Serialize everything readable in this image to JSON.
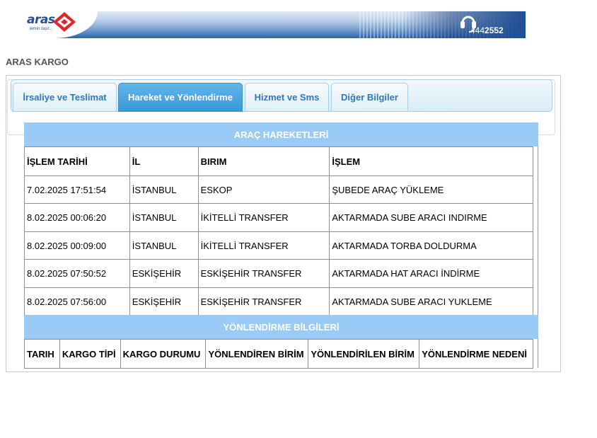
{
  "brand": {
    "logo_text": "aras",
    "slogan": "lemin taşır...",
    "phone_prefix": "444",
    "phone_suffix": "2552",
    "colors": {
      "banner_dark": "#1e4f93",
      "logo_red": "#e3262d",
      "tab_active": "#3b98d8",
      "section_header": "#99cbf6"
    }
  },
  "page_title": "ARAS KARGO",
  "tabs": [
    {
      "label": "İrsaliye ve Teslimat",
      "active": false
    },
    {
      "label": "Hareket ve Yönlendirme",
      "active": true
    },
    {
      "label": "Hizmet ve Sms",
      "active": false
    },
    {
      "label": "Diğer Bilgiler",
      "active": false
    }
  ],
  "vehicle_movements": {
    "title": "ARAÇ HAREKETLERİ",
    "columns": [
      "İŞLEM TARİHİ",
      "İL",
      "BIRIM",
      "İŞLEM"
    ],
    "rows": [
      [
        "7.02.2025 17:51:54",
        "İSTANBUL",
        "ESKOP",
        "ŞUBEDE ARAÇ YÜKLEME"
      ],
      [
        "8.02.2025 00:06:20",
        "İSTANBUL",
        "İKİTELLİ TRANSFER",
        "AKTARMADA SUBE ARACI INDIRME"
      ],
      [
        "8.02.2025 00:09:00",
        "İSTANBUL",
        "İKİTELLİ TRANSFER",
        "AKTARMADA TORBA DOLDURMA"
      ],
      [
        "8.02.2025 07:50:52",
        "ESKİŞEHİR",
        "ESKİŞEHİR TRANSFER",
        "AKTARMADA HAT ARACI İNDİRME"
      ],
      [
        "8.02.2025 07:56:00",
        "ESKİŞEHİR",
        "ESKİŞEHİR TRANSFER",
        "AKTARMADA SUBE ARACI YUKLEME"
      ]
    ]
  },
  "routing_info": {
    "title": "YÖNLENDİRME BİLGİLERİ",
    "columns": [
      "TARIH",
      "KARGO TİPİ",
      "KARGO DURUMU",
      "YÖNLENDİREN BİRİM",
      "YÖNLENDİRİLEN BİRİM",
      "YÖNLENDİRME NEDENİ"
    ]
  }
}
